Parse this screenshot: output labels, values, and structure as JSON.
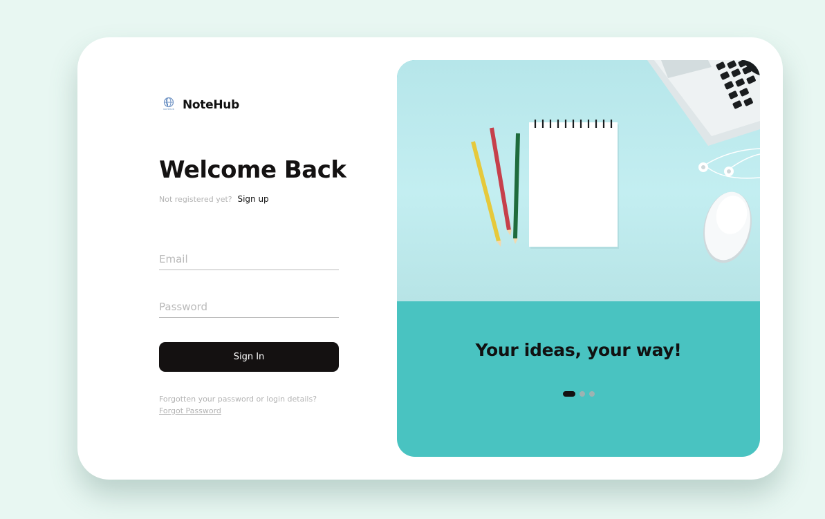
{
  "brand": {
    "name": "NoteHub",
    "logo_caption": "NOTEHUB"
  },
  "login": {
    "title": "Welcome Back",
    "not_registered_text": "Not registered yet?",
    "signup_link": "Sign up",
    "email_placeholder": "Email",
    "password_placeholder": "Password",
    "signin_label": "Sign In",
    "forgot_prompt": "Forgotten your password or login details?",
    "forgot_link": "Forgot Password"
  },
  "promo": {
    "tagline": "Your ideas, your way!",
    "carousel": {
      "slide_count": 3,
      "active_index": 0
    }
  },
  "colors": {
    "background": "#e8f7f2",
    "primary_button": "#141111",
    "accent_teal": "#49c3c1"
  }
}
